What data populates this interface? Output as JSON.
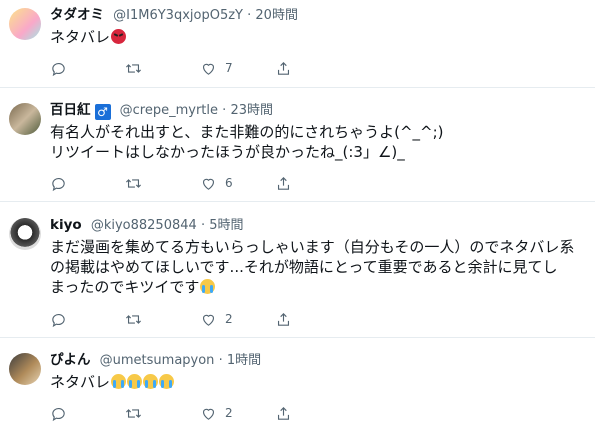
{
  "tweets": [
    {
      "name": "タダオミ",
      "handle": "@I1M6Y3qxjopO5zY",
      "time": "20時間",
      "lines": [
        "ネタバレ"
      ],
      "emoji": [
        "angry"
      ],
      "likes": "7",
      "retweets": ""
    },
    {
      "name": "百日紅",
      "badge": "♂",
      "handle": "@crepe_myrtle",
      "time": "23時間",
      "lines": [
        "有名人がそれ出すと、また非難の的にされちゃうよ(^_^;)",
        "リツイートはしなかったほうが良かったね_(:3」∠)_"
      ],
      "likes": "6",
      "retweets": ""
    },
    {
      "name": "kiyo",
      "handle": "@kiyo88250844",
      "time": "5時間",
      "lines": [
        "まだ漫画を集めてる方もいらっしゃいます（自分もその一人）のでネタバレ系",
        "の掲載はやめてほしいです...それが物語にとって重要であると余計に見てし",
        "まったのでキツイです"
      ],
      "emoji": [
        "cry"
      ],
      "likes": "2",
      "retweets": ""
    },
    {
      "name": "ぴよん",
      "handle": "@umetsumapyon",
      "time": "1時間",
      "lines": [
        "ネタバレ"
      ],
      "emoji": [
        "cry",
        "cry",
        "cry",
        "cry"
      ],
      "likes": "2",
      "retweets": ""
    }
  ],
  "separator": "·",
  "colors": {
    "text": "#0f1419",
    "muted": "#536471",
    "divider": "#e6ecf0",
    "badge": "#1a6fd8"
  },
  "icons": [
    "reply-icon",
    "retweet-icon",
    "like-icon",
    "share-icon"
  ]
}
